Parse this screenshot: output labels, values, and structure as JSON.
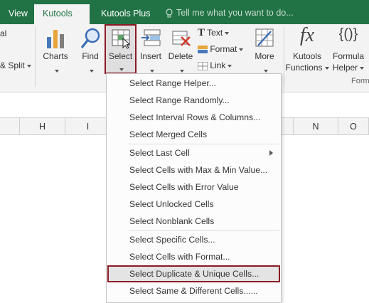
{
  "tabs": [
    {
      "label": "View",
      "active": false
    },
    {
      "label": "Kutools ™",
      "active": true
    },
    {
      "label": "Kutools Plus",
      "active": false
    }
  ],
  "tell_me": "Tell me what you want to do...",
  "ribbon": {
    "partial_top": "al",
    "partial_split": "& Split",
    "charts": "Charts",
    "find": "Find",
    "select": "Select",
    "insert": "Insert",
    "delete": "Delete",
    "text": "Text",
    "format": "Format",
    "link": "Link",
    "more": "More",
    "kutools_functions_1": "Kutools",
    "kutools_functions_2": "Functions",
    "formula_helper_1": "Formula",
    "formula_helper_2": "Helper",
    "group_label_partial": "Form"
  },
  "columns": [
    "H",
    "I",
    "N",
    "O"
  ],
  "menu": {
    "items": [
      "Select Range Helper...",
      "Select Range Randomly...",
      "Select Interval Rows & Columns...",
      "Select Merged Cells",
      "Select Last Cell",
      "Select Cells with Max & Min Value...",
      "Select Cells with Error Value",
      "Select Unlocked Cells",
      "Select Nonblank Cells",
      "Select Specific Cells...",
      "Select Cells with Format...",
      "Select Duplicate & Unique Cells...",
      "Select Same & Different Cells......"
    ]
  },
  "colors": {
    "excel_green": "#217346",
    "highlight_border": "#8b1a25"
  }
}
